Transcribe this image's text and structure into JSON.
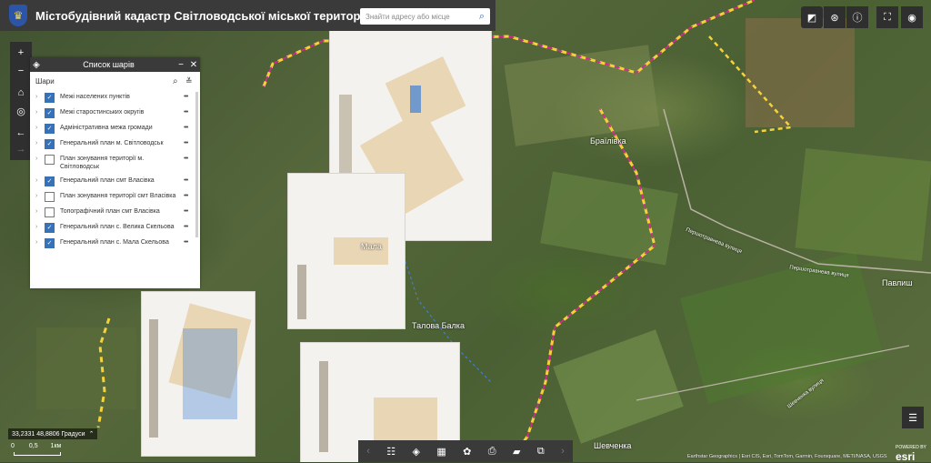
{
  "header": {
    "title": "Містобудівний кадастр Світловодської міської територіальної громади"
  },
  "search": {
    "placeholder": "Знайти адресу або місце"
  },
  "panel": {
    "title": "Список шарів",
    "subtitle": "Шари",
    "layers": [
      {
        "label": "Межі населених пунктів",
        "checked": true
      },
      {
        "label": "Межі старостинських округів",
        "checked": true
      },
      {
        "label": "Адміністративна межа громади",
        "checked": true
      },
      {
        "label": "Генеральний план м. Світловодськ",
        "checked": true
      },
      {
        "label": "План зонування території м. Світловодськ",
        "checked": false
      },
      {
        "label": "Генеральний план смт Власівка",
        "checked": true
      },
      {
        "label": "План зонування території смт Власівка",
        "checked": false
      },
      {
        "label": "Топографічний план смт Власівка",
        "checked": false
      },
      {
        "label": "Генеральний план с. Велика Скельова",
        "checked": true
      },
      {
        "label": "Генеральний план с. Мала Скельова",
        "checked": true
      }
    ]
  },
  "map_labels": {
    "braylivka": "Браїлівка",
    "mala": "Мала",
    "talova": "Талова Балка",
    "pavlysh": "Павлиш",
    "shevchenka": "Шевченка",
    "pershotravneva": "Першотравнева вулиця",
    "shevchenka_street": "Шевченка вулиця"
  },
  "status": {
    "coords": "33,2331 48,8806 Градуси",
    "scale_labels": [
      "0",
      "0,5",
      "1км"
    ]
  },
  "attribution": "Earthstar Geographics | Esri CIS, Esri, TomTom, Garmin, Foursquare, METI/NASA, USGS",
  "branding": {
    "powered": "POWERED BY",
    "name": "esri"
  }
}
